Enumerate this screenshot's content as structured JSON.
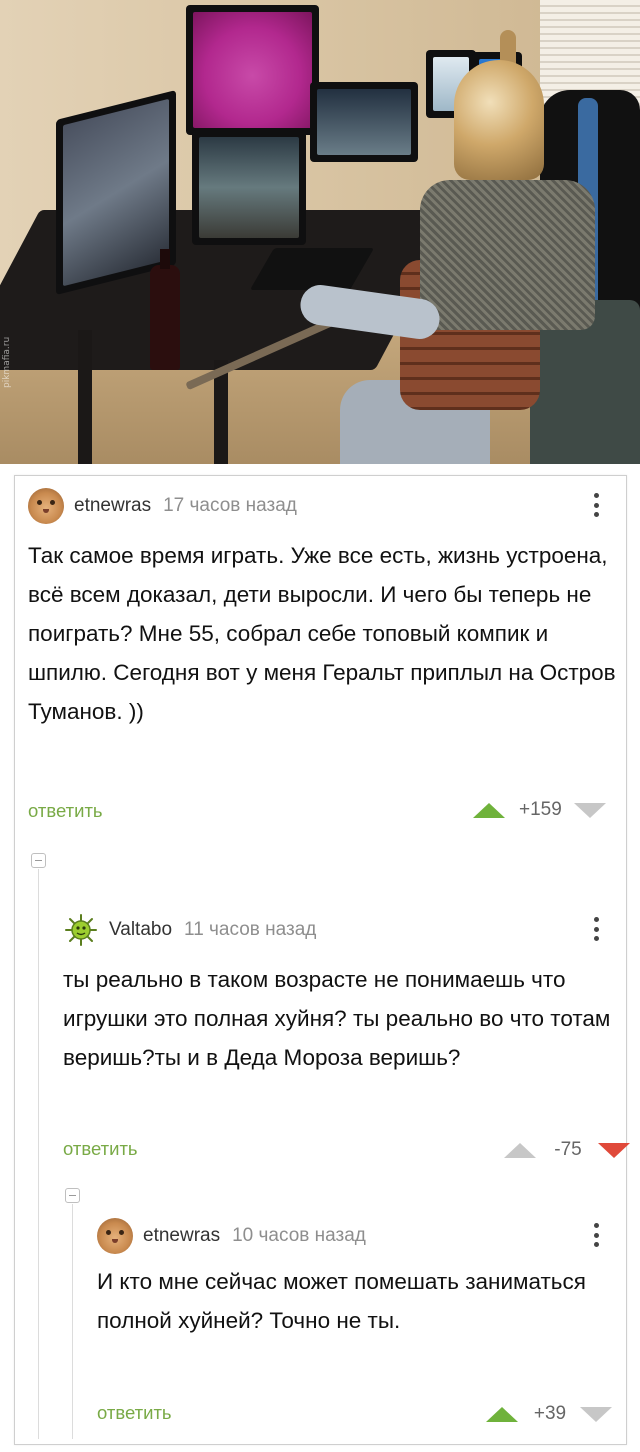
{
  "photo": {
    "watermark": "pikmafia.ru"
  },
  "comments": [
    {
      "author": "etnewras",
      "time": "17 часов назад",
      "text": "Так самое время играть. Уже все есть, жизнь устроена, всё всем доказал, дети выросли. И чего бы теперь не поиграть? Мне 55, собрал себе топовый компик и шпилю. Сегодня вот у меня Геральт приплыл на Остров Туманов. ))",
      "reply_label": "ответить",
      "score": "+159",
      "upvoted": true,
      "downvoted": false
    },
    {
      "author": "Valtabo",
      "time": "11 часов назад",
      "text": "ты реально в таком возрасте не понимаешь что игрушки это полная хуйня? ты реально во что тотам веришь?ты и в Деда Мороза веришь?",
      "reply_label": "ответить",
      "score": "-75",
      "upvoted": false,
      "downvoted": true
    },
    {
      "author": "etnewras",
      "time": "10 часов назад",
      "text": "И кто мне сейчас может помешать заниматься полной хуйней? Точно не ты.",
      "reply_label": "ответить",
      "score": "+39",
      "upvoted": true,
      "downvoted": false
    }
  ],
  "colors": {
    "reply_green": "#79aa46",
    "upvote_green": "#6fb23b",
    "downvote_red": "#e0493a",
    "inactive_gray": "#c7c7c7"
  }
}
